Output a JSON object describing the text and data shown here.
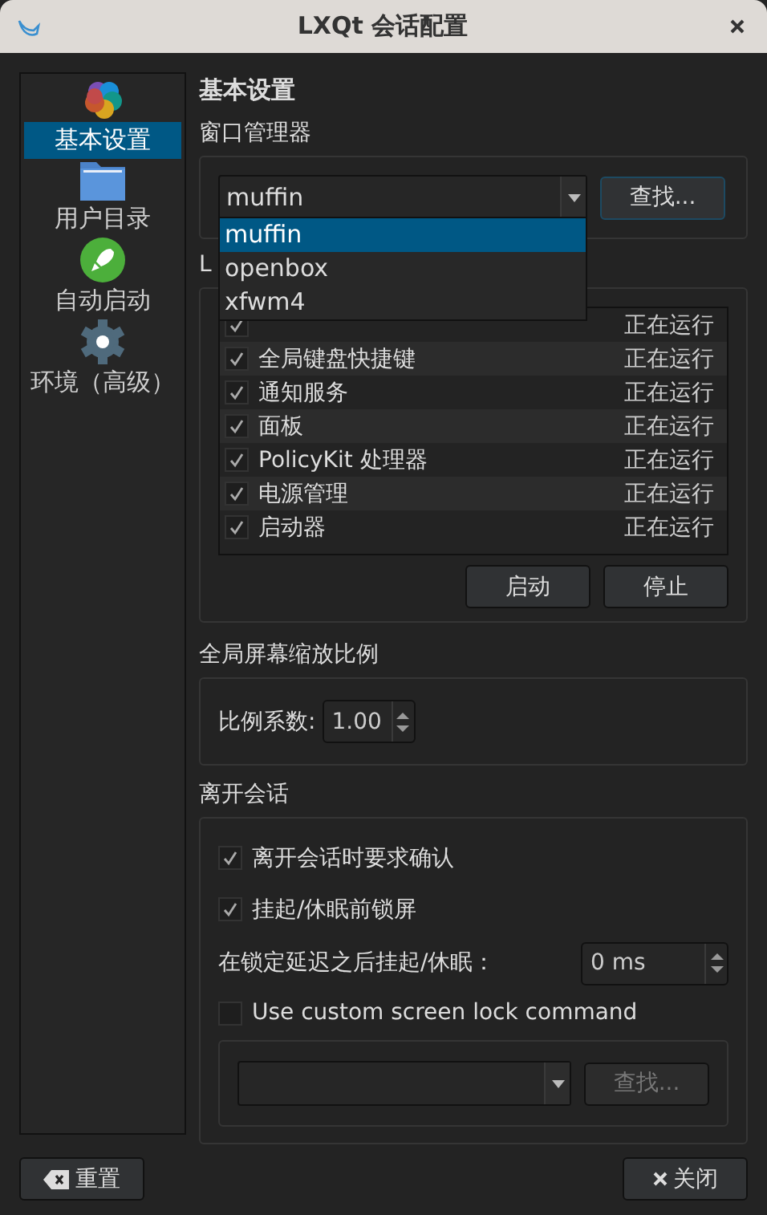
{
  "window": {
    "title": "LXQt 会话配置"
  },
  "sidebar": {
    "items": [
      {
        "label": "基本设置",
        "selected": true
      },
      {
        "label": "用户目录",
        "selected": false
      },
      {
        "label": "自动启动",
        "selected": false
      },
      {
        "label": "环境（高级）",
        "selected": false
      }
    ]
  },
  "page_title": "基本设置",
  "window_manager": {
    "title": "窗口管理器",
    "value": "muffin",
    "find_button": "查找...",
    "dropdown": {
      "options": [
        {
          "label": "muffin",
          "selected": true
        },
        {
          "label": "openbox",
          "selected": false
        },
        {
          "label": "xfwm4",
          "selected": false
        }
      ]
    }
  },
  "modules": {
    "title": "L",
    "rows": [
      {
        "status": "正在运行",
        "checked": true
      },
      {
        "name": "全局键盘快捷键",
        "status": "正在运行",
        "checked": true
      },
      {
        "name": "通知服务",
        "status": "正在运行",
        "checked": true
      },
      {
        "name": "面板",
        "status": "正在运行",
        "checked": true
      },
      {
        "name": "PolicyKit 处理器",
        "status": "正在运行",
        "checked": true
      },
      {
        "name": "电源管理",
        "status": "正在运行",
        "checked": true
      },
      {
        "name": "启动器",
        "status": "正在运行",
        "checked": true
      }
    ],
    "buttons": [
      "启动",
      "停止"
    ]
  },
  "scaling": {
    "title": "全局屏幕缩放比例",
    "label": "比例系数:",
    "value": "1.00"
  },
  "leave_session": {
    "title": "离开会话",
    "options": [
      {
        "label": "离开会话时要求确认",
        "checked": true
      },
      {
        "label": "挂起/休眠前锁屏",
        "checked": true
      }
    ],
    "delay_label": "在锁定延迟之后挂起/休眠：",
    "delay_value": "0 ms",
    "custom_lock": {
      "label": "Use custom screen lock command",
      "checked": false
    },
    "lock_find_button": {
      "label": "查找...",
      "disabled": true
    }
  },
  "footer": {
    "reset": "重置",
    "close": "关闭"
  }
}
